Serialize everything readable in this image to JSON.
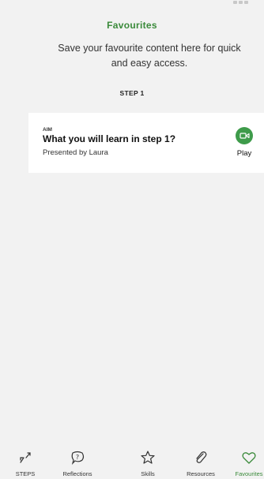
{
  "header": {
    "title": "Favourites"
  },
  "intro": {
    "line1": "Save your favourite content here for quick",
    "line2": "and easy access."
  },
  "section": {
    "heading": "STEP 1"
  },
  "card": {
    "kicker": "AIM",
    "title": "What you will learn in step 1?",
    "subtitle": "Presented by Laura",
    "play_label": "Play",
    "play_icon": "video-camera-icon"
  },
  "tabs": [
    {
      "label": "STEPS",
      "icon": "steps-arrows-icon"
    },
    {
      "label": "Reflections",
      "icon": "question-bubble-icon"
    },
    {
      "label": "Skills",
      "icon": "star-icon"
    },
    {
      "label": "Resources",
      "icon": "paperclip-icon"
    },
    {
      "label": "Favourites",
      "icon": "heart-icon",
      "active": true
    }
  ],
  "colors": {
    "accent": "#3a8a3a",
    "play_button": "#3e9b4a",
    "background": "#f2f2f2",
    "card": "#ffffff"
  }
}
